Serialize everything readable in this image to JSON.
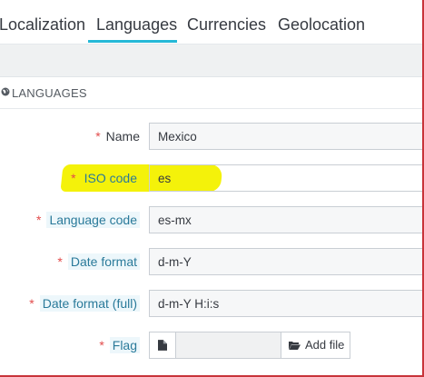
{
  "tabs": [
    {
      "label": "Localization"
    },
    {
      "label": "Languages"
    },
    {
      "label": "Currencies"
    },
    {
      "label": "Geolocation"
    }
  ],
  "panel": {
    "title": "LANGUAGES",
    "icon": "globe-icon"
  },
  "form": {
    "name": {
      "label": "Name",
      "required": "*",
      "value": "Mexico"
    },
    "iso_code": {
      "label": "ISO code",
      "required": "*",
      "value": "es"
    },
    "language_code": {
      "label": "Language code",
      "required": "*",
      "value": "es-mx"
    },
    "date_format": {
      "label": "Date format",
      "required": "*",
      "value": "d-m-Y"
    },
    "date_format_full": {
      "label": "Date format (full)",
      "required": "*",
      "value": "d-m-Y H:i:s"
    },
    "flag": {
      "label": "Flag",
      "required": "*",
      "add_file": "Add file",
      "icon": "file-icon",
      "button_icon": "folder-open-icon"
    }
  },
  "colors": {
    "accent": "#25b9d7",
    "required": "#e24b4b",
    "highlight_marker": "#f4f20a",
    "frame": "#c8343a"
  }
}
